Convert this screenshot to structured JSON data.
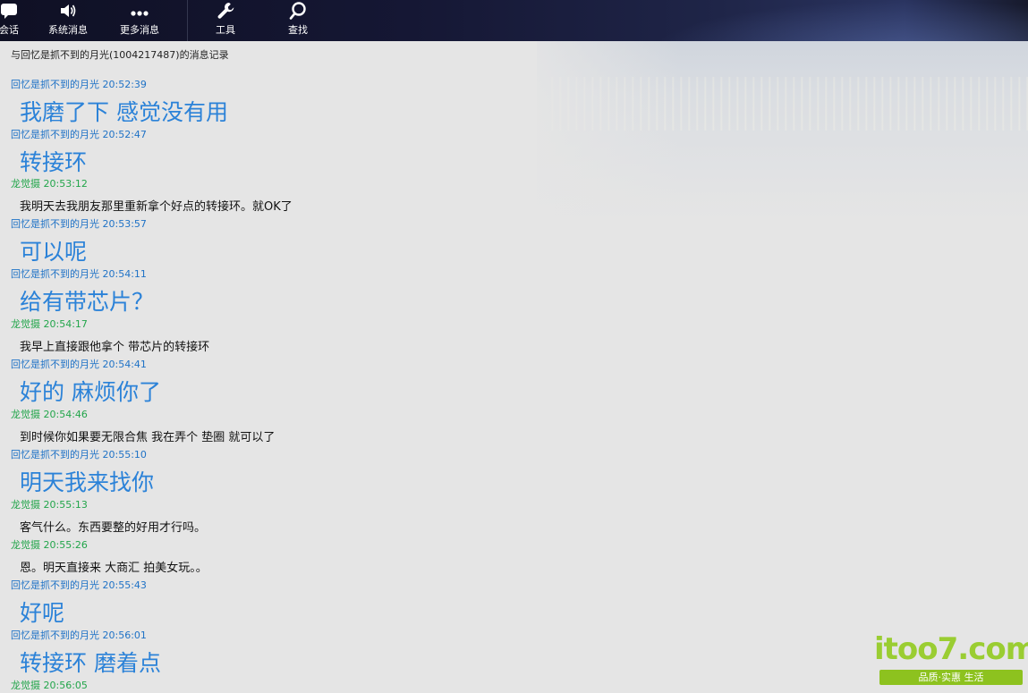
{
  "toolbar": {
    "items": [
      {
        "label": "会话",
        "icon": "chat-icon"
      },
      {
        "label": "系统消息",
        "icon": "speaker-icon"
      },
      {
        "label": "更多消息",
        "icon": "more-icon"
      },
      {
        "label": "工具",
        "icon": "wrench-icon"
      },
      {
        "label": "查找",
        "icon": "search-icon"
      }
    ]
  },
  "record_title": "与回忆是抓不到的月光(1004217487)的消息记录",
  "messages": [
    {
      "sender": "回忆是抓不到的月光",
      "time": "20:52:39",
      "header": "回忆是抓不到的月光 20:52:39",
      "text": "我磨了下 感觉没有用",
      "side": "them"
    },
    {
      "sender": "回忆是抓不到的月光",
      "time": "20:52:47",
      "header": "回忆是抓不到的月光 20:52:47",
      "text": "转接环",
      "side": "them"
    },
    {
      "sender": "龙觉摄",
      "time": "20:53:12",
      "header": "龙觉摄 20:53:12",
      "text": "我明天去我朋友那里重新拿个好点的转接环。就OK了",
      "side": "me"
    },
    {
      "sender": "回忆是抓不到的月光",
      "time": "20:53:57",
      "header": "回忆是抓不到的月光 20:53:57",
      "text": "可以呢",
      "side": "them"
    },
    {
      "sender": "回忆是抓不到的月光",
      "time": "20:54:11",
      "header": "回忆是抓不到的月光 20:54:11",
      "text": "给有带芯片？",
      "side": "them"
    },
    {
      "sender": "龙觉摄",
      "time": "20:54:17",
      "header": "龙觉摄 20:54:17",
      "text": "我早上直接跟他拿个 带芯片的转接环",
      "side": "me"
    },
    {
      "sender": "回忆是抓不到的月光",
      "time": "20:54:41",
      "header": "回忆是抓不到的月光 20:54:41",
      "text": "好的 麻烦你了",
      "side": "them"
    },
    {
      "sender": "龙觉摄",
      "time": "20:54:46",
      "header": "龙觉摄 20:54:46",
      "text": "到时候你如果要无限合焦  我在弄个 垫圈 就可以了",
      "side": "me"
    },
    {
      "sender": "回忆是抓不到的月光",
      "time": "20:55:10",
      "header": "回忆是抓不到的月光 20:55:10",
      "text": "明天我来找你",
      "side": "them"
    },
    {
      "sender": "龙觉摄",
      "time": "20:55:13",
      "header": "龙觉摄 20:55:13",
      "text": "客气什么。东西要整的好用才行吗。",
      "side": "me"
    },
    {
      "sender": "龙觉摄",
      "time": "20:55:26",
      "header": "龙觉摄 20:55:26",
      "text": "恩。明天直接来 大商汇 拍美女玩。。",
      "side": "me"
    },
    {
      "sender": "回忆是抓不到的月光",
      "time": "20:55:43",
      "header": "回忆是抓不到的月光 20:55:43",
      "text": "好呢",
      "side": "them"
    },
    {
      "sender": "回忆是抓不到的月光",
      "time": "20:56:01",
      "header": "回忆是抓不到的月光 20:56:01",
      "text": "转接环 磨着点",
      "side": "them"
    },
    {
      "sender": "龙觉摄",
      "time": "20:56:05",
      "header": "龙觉摄 20:56:05",
      "text": "",
      "side": "me"
    }
  ],
  "watermark": {
    "logo": "itoo7.com",
    "slogan": "品质·实惠 生活"
  },
  "colors": {
    "them": "#1f72c6",
    "me": "#22a54a",
    "big_text": "#2b82d8"
  }
}
